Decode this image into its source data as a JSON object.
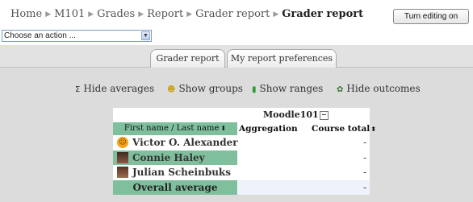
{
  "breadcrumb": {
    "items": [
      "Home",
      "M101",
      "Grades",
      "Report",
      "Grader report"
    ],
    "current": "Grader report"
  },
  "editing_button": "Turn editing on",
  "action_select": {
    "value": "Choose an action ..."
  },
  "tabs": [
    {
      "label": "Grader report"
    },
    {
      "label": "My report preferences"
    }
  ],
  "controls": [
    {
      "label": "Hide averages",
      "icon": "sigma-icon"
    },
    {
      "label": "Show groups",
      "icon": "group-icon"
    },
    {
      "label": "Show ranges",
      "icon": "bar-chart-icon"
    },
    {
      "label": "Hide outcomes",
      "icon": "outcomes-icon"
    }
  ],
  "grades": {
    "course": "Moodle101",
    "header_name": "First name / Last name",
    "header_aggregation": "Aggregation",
    "header_total": "Course total",
    "students": [
      {
        "name": "Victor O. Alexander",
        "total": "-"
      },
      {
        "name": "Connie Haley",
        "total": "-"
      },
      {
        "name": "Julian Scheinbuks",
        "total": "-"
      }
    ],
    "average_label": "Overall average",
    "average_value": "-"
  },
  "colors": {
    "highlight": "#7fbf9e",
    "background": "#dcdcdc",
    "average_cell": "#eef2fb"
  }
}
